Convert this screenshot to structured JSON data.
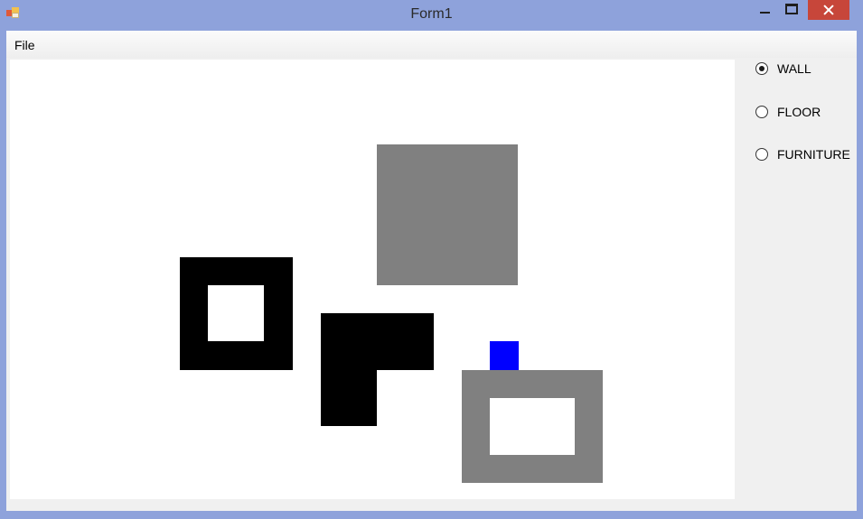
{
  "window": {
    "title": "Form1"
  },
  "menu": {
    "items": [
      {
        "label": "File"
      }
    ]
  },
  "tools": {
    "options": [
      {
        "label": "WALL",
        "selected": true
      },
      {
        "label": "FLOOR",
        "selected": false
      },
      {
        "label": "FURNITURE",
        "selected": false
      }
    ]
  },
  "canvas": {
    "background": "#ffffff",
    "colors": {
      "wall": "#000000",
      "floor": "#808080",
      "furniture": "#0000ff"
    }
  }
}
